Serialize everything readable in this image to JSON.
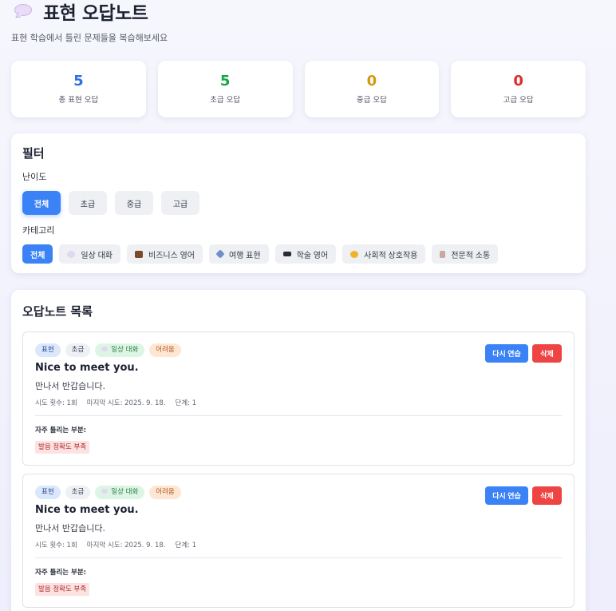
{
  "header": {
    "icon": "speech-bubble-icon",
    "title": "표현 오답노트",
    "subtitle": "표현 학습에서 틀린 문제들을 복습해보세요"
  },
  "stats": [
    {
      "value": "5",
      "label": "총 표현 오답",
      "color": "#2f6fe4"
    },
    {
      "value": "5",
      "label": "초급 오답",
      "color": "#17a34a"
    },
    {
      "value": "0",
      "label": "중급 오답",
      "color": "#d39a10"
    },
    {
      "value": "0",
      "label": "고급 오답",
      "color": "#dc2b2b"
    }
  ],
  "filter": {
    "title": "필터",
    "difficulty_label": "난이도",
    "difficulty_options": [
      "전체",
      "초급",
      "중급",
      "고급"
    ],
    "difficulty_selected": "전체",
    "category_label": "카테고리",
    "category_options": [
      {
        "label": "전체",
        "icon": ""
      },
      {
        "label": "일상 대화",
        "icon": "speech-bubble-icon"
      },
      {
        "label": "비즈니스 영어",
        "icon": "briefcase-icon"
      },
      {
        "label": "여행 표현",
        "icon": "airplane-icon"
      },
      {
        "label": "학술 영어",
        "icon": "graduation-cap-icon"
      },
      {
        "label": "사회적 상호작용",
        "icon": "handshake-icon"
      },
      {
        "label": "전문적 소통",
        "icon": "office-building-icon"
      }
    ],
    "category_selected": "전체"
  },
  "list": {
    "title": "오답노트 목록",
    "notes": [
      {
        "tags": {
          "type": "표현",
          "level": "초급",
          "category": "일상 대화",
          "difficulty": "어려움"
        },
        "english": "Nice to meet you.",
        "korean": "만나서 반갑습니다.",
        "attempts": "시도 횟수: 1회",
        "last_attempt": "마지막 시도: 2025. 9. 18.",
        "stage": "단계: 1",
        "weak_label": "자주 틀리는 부분:",
        "weak_points": [
          "발음 정확도 부족"
        ],
        "retry_label": "다시 연습",
        "delete_label": "삭제"
      },
      {
        "tags": {
          "type": "표현",
          "level": "초급",
          "category": "일상 대화",
          "difficulty": "어려움"
        },
        "english": "Nice to meet you.",
        "korean": "만나서 반갑습니다.",
        "attempts": "시도 횟수: 1회",
        "last_attempt": "마지막 시도: 2025. 9. 18.",
        "stage": "단계: 1",
        "weak_label": "자주 틀리는 부분:",
        "weak_points": [
          "발음 정확도 부족"
        ],
        "retry_label": "다시 연습",
        "delete_label": "삭제"
      }
    ]
  }
}
